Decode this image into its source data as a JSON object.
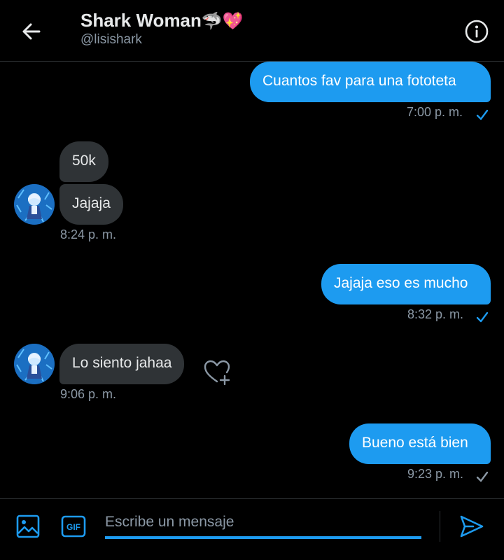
{
  "header": {
    "name": "Shark Woman",
    "name_emoji": "🦈💖",
    "handle": "@lisishark"
  },
  "messages": [
    {
      "direction": "out",
      "text": "Cuantos fav para una fototeta",
      "time": "7:00 p. m.",
      "read": true
    },
    {
      "direction": "in",
      "text": "50k"
    },
    {
      "direction": "in",
      "text": "Jajaja",
      "time": "8:24 p. m."
    },
    {
      "direction": "out",
      "text": "Jajaja eso es mucho",
      "time": "8:32 p. m.",
      "read": true
    },
    {
      "direction": "in",
      "text": "Lo siento jahaa",
      "time": "9:06 p. m."
    },
    {
      "direction": "out",
      "text": "Bueno está bien",
      "time": "9:23 p. m.",
      "read": false
    }
  ],
  "composer": {
    "placeholder": "Escribe un mensaje",
    "gif_label": "GIF"
  },
  "colors": {
    "accent": "#1d9bf0",
    "background": "#000000",
    "incoming_bubble": "#2f3336",
    "muted_text": "#8b98a5"
  },
  "icons": [
    "back-arrow-icon",
    "info-icon",
    "check-icon",
    "heart-plus-icon",
    "image-icon",
    "gif-icon",
    "send-icon"
  ]
}
